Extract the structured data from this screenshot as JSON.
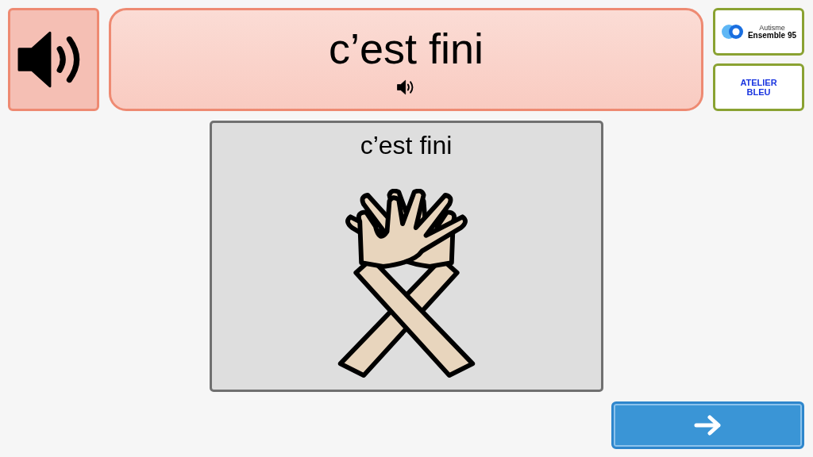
{
  "sentence": {
    "text": "c’est fini"
  },
  "logos": [
    {
      "kind": "ensemble",
      "lines": [
        "Autisme",
        "Ensemble 95"
      ]
    },
    {
      "kind": "atelier",
      "lines": [
        "ATELIER",
        "BLEU"
      ]
    }
  ],
  "card": {
    "label": "c’est fini"
  }
}
